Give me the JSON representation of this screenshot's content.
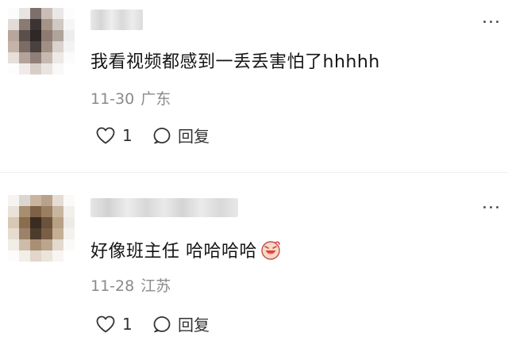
{
  "comments": [
    {
      "text": "我看视频都感到一丢丢害怕了hhhhh",
      "date": "11-30",
      "location": "广东",
      "likes": "1",
      "reply_label": "回复",
      "avatar_colors": [
        "#fcfcfc",
        "#e8e4e2",
        "#7d6f6b",
        "#c9bdb5",
        "#eae8e6",
        "#fdfdfd",
        "#e2dcd8",
        "#8a7a74",
        "#3c3432",
        "#a59388",
        "#cfc8c3",
        "#f6f6f6",
        "#b8a69c",
        "#5b4f4b",
        "#2f2827",
        "#8d7b72",
        "#b0a39a",
        "#ededed",
        "#c4b3a8",
        "#7c6c66",
        "#4a403d",
        "#a28f84",
        "#d9d2cd",
        "#f3f3f3",
        "#e6dfda",
        "#b3a39a",
        "#8f7f78",
        "#c7b9af",
        "#ece9e7",
        "#fbfbfb",
        "#fdfdfd",
        "#f0ebe8",
        "#d8cec8",
        "#e9e4e0",
        "#f8f8f8",
        "#ffffff"
      ]
    },
    {
      "text": "好像班主任 哈哈哈哈",
      "date": "11-28",
      "location": "江苏",
      "likes": "1",
      "reply_label": "回复",
      "avatar_colors": [
        "#f6f4f2",
        "#dcd6d1",
        "#c9b59f",
        "#b8a28b",
        "#e4ddd6",
        "#fbfaf9",
        "#e9e2d8",
        "#a88d70",
        "#7d6248",
        "#9b7f63",
        "#c8b59f",
        "#f2efec",
        "#d8c8b3",
        "#8a6c4f",
        "#3a2c21",
        "#6b523c",
        "#b9a085",
        "#eeeae5",
        "#e5dccf",
        "#9c8268",
        "#4d3b2c",
        "#7a5f46",
        "#c4ae95",
        "#f4f1ee",
        "#f1ece5",
        "#cdbca7",
        "#a98f74",
        "#bba58c",
        "#e3d9cd",
        "#fbfaf8",
        "#fdfcfb",
        "#f2eee9",
        "#e1d6c9",
        "#ebe4db",
        "#f7f5f2",
        "#ffffff"
      ]
    }
  ],
  "icons": {
    "like": "heart-outline-icon",
    "reply": "speech-bubble-icon",
    "more": "more-dots-icon",
    "emoji": "laughing-emoji-icon"
  },
  "colors": {
    "meta_text": "#8a8a8a",
    "body_text": "#151515",
    "icon": "#333333"
  }
}
